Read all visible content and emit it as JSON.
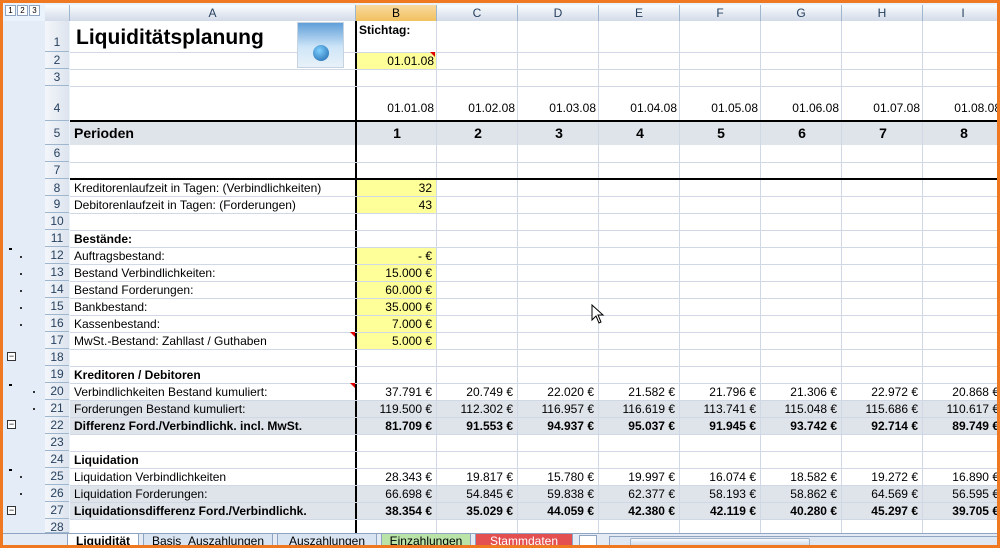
{
  "outline_levels": [
    "1",
    "2",
    "3"
  ],
  "columns": [
    "A",
    "B",
    "C",
    "D",
    "E",
    "F",
    "G",
    "H",
    "I"
  ],
  "selected_column": "B",
  "rows": [
    "1",
    "2",
    "3",
    "4",
    "5",
    "6",
    "7",
    "8",
    "9",
    "10",
    "11",
    "12",
    "13",
    "14",
    "15",
    "16",
    "17",
    "18",
    "19",
    "20",
    "21",
    "22",
    "23",
    "24",
    "25",
    "26",
    "27",
    "28"
  ],
  "title": "Liquiditätsplanung",
  "stichtag_label": "Stichtag:",
  "stichtag_value": "01.01.08",
  "dates": [
    "01.01.08",
    "01.02.08",
    "01.03.08",
    "01.04.08",
    "01.05.08",
    "01.06.08",
    "01.07.08",
    "01.08.08"
  ],
  "perioden_label": "Perioden",
  "periods": [
    "1",
    "2",
    "3",
    "4",
    "5",
    "6",
    "7",
    "8"
  ],
  "params": [
    {
      "label": "Kreditorenlaufzeit in Tagen: (Verbindlichkeiten)",
      "value": "32"
    },
    {
      "label": "Debitorenlaufzeit in Tagen: (Forderungen)",
      "value": "43"
    }
  ],
  "bestaende_header": "Bestände:",
  "bestaende": [
    {
      "label": "Auftragsbestand:",
      "value": "- €"
    },
    {
      "label": "Bestand Verbindlichkeiten:",
      "value": "15.000 €"
    },
    {
      "label": "Bestand Forderungen:",
      "value": "60.000 €"
    },
    {
      "label": "Bankbestand:",
      "value": "35.000 €"
    },
    {
      "label": "Kassenbestand:",
      "value": "7.000 €"
    },
    {
      "label": "MwSt.-Bestand: Zahllast / Guthaben",
      "value": "5.000 €"
    }
  ],
  "kreditoren_header": "Kreditoren / Debitoren",
  "kreditoren_rows": [
    {
      "label": "Verbindlichkeiten Bestand kumuliert:",
      "values": [
        "37.791 €",
        "20.749 €",
        "22.020 €",
        "21.582 €",
        "21.796 €",
        "21.306 €",
        "22.972 €",
        "20.868 €"
      ]
    },
    {
      "label": "Forderungen Bestand kumuliert:",
      "values": [
        "119.500 €",
        "112.302 €",
        "116.957 €",
        "116.619 €",
        "113.741 €",
        "115.048 €",
        "115.686 €",
        "110.617 €"
      ]
    },
    {
      "label": "Differenz Ford./Verbindlichk. incl. MwSt.",
      "values": [
        "81.709 €",
        "91.553 €",
        "94.937 €",
        "95.037 €",
        "91.945 €",
        "93.742 €",
        "92.714 €",
        "89.749 €"
      ]
    }
  ],
  "liquidation_header": "Liquidation",
  "liquidation_rows": [
    {
      "label": "Liquidation Verbindlichkeiten",
      "values": [
        "28.343 €",
        "19.817 €",
        "15.780 €",
        "19.997 €",
        "16.074 €",
        "18.582 €",
        "19.272 €",
        "16.890 €"
      ]
    },
    {
      "label": "Liquidation Forderungen:",
      "values": [
        "66.698 €",
        "54.845 €",
        "59.838 €",
        "62.377 €",
        "58.193 €",
        "58.862 €",
        "64.569 €",
        "56.595 €"
      ]
    },
    {
      "label": "Liquidationsdifferenz Ford./Verbindlichk.",
      "values": [
        "38.354 €",
        "35.029 €",
        "44.059 €",
        "42.380 €",
        "42.119 €",
        "40.280 €",
        "45.297 €",
        "39.705 €"
      ]
    }
  ],
  "sheet_tabs": [
    "Liquidität",
    "Basis_Auszahlungen",
    "Auszahlungen",
    "Einzahlungen",
    "Stammdaten"
  ],
  "colors": {
    "frame": "#f07820",
    "selected_column": "#f1c15f",
    "input_cells": "#ffff99",
    "shaded_rows": "#dfe3ea"
  }
}
